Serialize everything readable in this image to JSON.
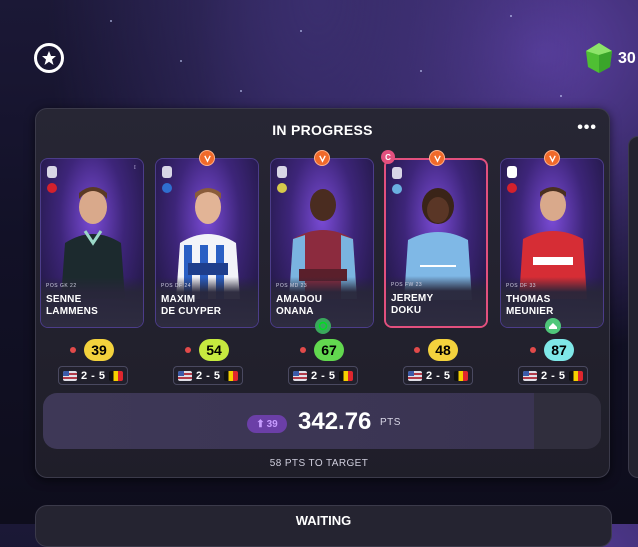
{
  "header": {
    "gem_count": "30",
    "colors": {
      "gem": "#58c93c"
    }
  },
  "panel": {
    "title": "IN PROGRESS",
    "more_label": "•••"
  },
  "cards": [
    {
      "first": "SENNE",
      "last": "LAMMENS",
      "meta": "POS GK 22",
      "score": "39",
      "score_color": "#f3d23d",
      "fixture_home": "2",
      "fixture_away": "5",
      "captain": false
    },
    {
      "first": "MAXIM",
      "last": "DE CUYPER",
      "meta": "POS DF 24",
      "score": "54",
      "score_color": "#c6ea3f",
      "fixture_home": "2",
      "fixture_away": "5",
      "captain": false
    },
    {
      "first": "AMADOU",
      "last": "ONANA",
      "meta": "POS MD 23",
      "score": "67",
      "score_color": "#62d84f",
      "fixture_home": "2",
      "fixture_away": "5",
      "captain": false
    },
    {
      "first": "JEREMY",
      "last": "DOKU",
      "meta": "POS FW 23",
      "score": "48",
      "score_color": "#f3d23d",
      "fixture_home": "2",
      "fixture_away": "5",
      "captain": true
    },
    {
      "first": "THOMAS",
      "last": "MEUNIER",
      "meta": "POS DF 33",
      "score": "87",
      "score_color": "#7fe8e8",
      "fixture_home": "2",
      "fixture_away": "5",
      "captain": false
    }
  ],
  "captain_label": "C",
  "fixture_sep": "-",
  "totals": {
    "delta": "39",
    "points": "342.76",
    "points_unit": "PTS",
    "target": "58 PTS TO TARGET"
  },
  "waiting": {
    "title": "WAITING"
  }
}
